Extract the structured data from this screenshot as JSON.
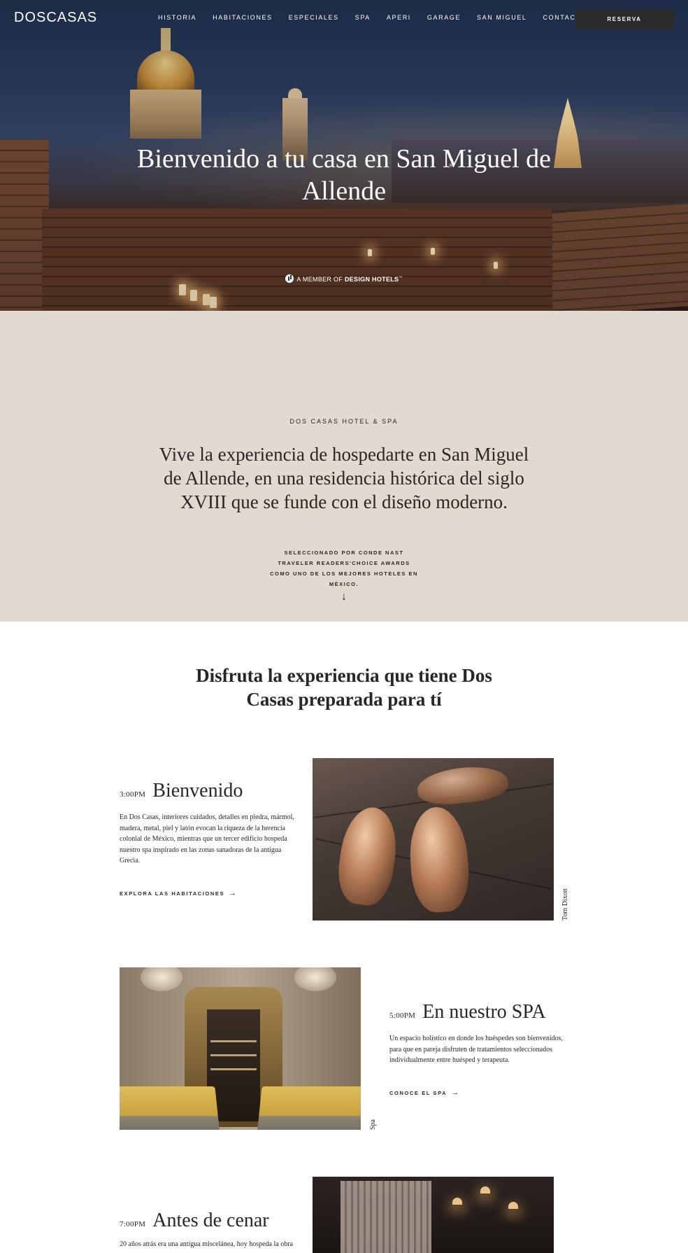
{
  "header": {
    "logo": "DOSCASAS",
    "nav": [
      "HISTORIA",
      "HABITACIONES",
      "ESPECIALES",
      "SPA",
      "APERI",
      "GARAGE",
      "SAN MIGUEL",
      "CONTACTO"
    ],
    "reserve_label": "RESERVA"
  },
  "hero": {
    "title": "Bienvenido a tu casa en San Miguel de Allende",
    "member_prefix": "A MEMBER OF",
    "member_brand": "DESIGN HOTELS",
    "member_tm": "™"
  },
  "intro": {
    "eyebrow": "DOS CASAS HOTEL & SPA",
    "text": "Vive la experiencia de hospedarte en San Miguel de Allende, en una residencia histórica del siglo XVIII que se funde con el diseño moderno.",
    "award": "SELECCIONADO POR CONDE NAST TRAVELER READERS'CHOICE AWARDS COMO UNO DE LOS MEJORES HOTELES EN MÉXICO.",
    "arrow": "↓"
  },
  "experiences": {
    "title": "Disfruta la experiencia que tiene Dos Casas preparada para tí",
    "items": [
      {
        "time": "3:00PM",
        "heading": "Bienvenido",
        "description": "En Dos Casas, interiores cuidados, detalles en piedra, mármol, madera, metal, piel y latón evocan la riqueza de la herencia colonial de México, mientras que un tercer edificio hospeda nuestro spa inspirado en las zonas sanadoras de la antigua Grecia.",
        "cta": "EXPLORA LAS HABITACIONES",
        "caption": "Tom Dixon"
      },
      {
        "time": "5:00PM",
        "heading": "En nuestro SPA",
        "description": "Un espacio holístico en donde los huéspedes son bienvenidos, para que en pareja disfruten de tratamientos seleccionados individualmente entre huésped y terapeuta.",
        "cta": "CONOCE EL SPA",
        "caption": "Spa"
      },
      {
        "time": "7:00PM",
        "heading": "Antes de cenar",
        "description": "20 años atrás era una antigua miscelánea, hoy hospeda la obra"
      }
    ],
    "cta_arrow": "→"
  },
  "icons": [
    "design-hotels-icon",
    "arrow-right-icon",
    "arrow-down-icon"
  ]
}
